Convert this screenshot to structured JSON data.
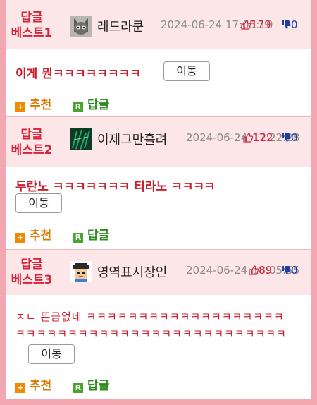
{
  "colors": {
    "outer_frame": "#f3a7b0",
    "header_bg": "#fde6e8",
    "accent_red": "#d6243b",
    "recommend_orange": "#f08a00",
    "reply_green": "#4aa52e",
    "downvote_blue": "#1b3fa6"
  },
  "entries": [
    {
      "badge_line1": "답글",
      "badge_line2": "베스트1",
      "avatar": "cat-avatar-icon",
      "nickname": "레드라쿤",
      "date": "2024-06-24",
      "time": "17:05:10",
      "upvotes": "179",
      "downvotes": "0",
      "content": "이게 뭔ㅋㅋㅋㅋㅋㅋㅋㅋ",
      "move_label": "이동",
      "recommend_label": "추천",
      "reply_label": "답글"
    },
    {
      "badge_line1": "답글",
      "badge_line2": "베스트2",
      "avatar": "green-texture-avatar-icon",
      "nickname": "이제그만흘려",
      "date": "2024-06-24",
      "time": "17:22:28",
      "upvotes": "122",
      "downvotes": "0",
      "content": "두란노 ㅋㅋㅋㅋㅋㅋㅋ 티라노 ㅋㅋㅋㅋ",
      "move_label": "이동",
      "recommend_label": "추천",
      "reply_label": "답글"
    },
    {
      "badge_line1": "답글",
      "badge_line2": "베스트3",
      "avatar": "pixel-character-avatar-icon",
      "nickname": "영역표시장인",
      "date": "2024-06-24",
      "time": "18:05:55",
      "upvotes": "89",
      "downvotes": "0",
      "content_line1": "ㅈㄴ 뜬금없네 ㅋㅋㅋㅋㅋㅋㅋㅋㅋㅋㅋㅋㅋㅋㅋㅋㅋㅋㅋ",
      "content_line2": "ㅋㅋㅋㅋㅋㅋㅋㅋㅋㅋㅋㅋㅋㅋㅋㅋㅋㅋㅋㅋㅋㅋㅋㅋㅋㅋ",
      "move_label": "이동",
      "recommend_label": "추천",
      "reply_label": "답글"
    }
  ]
}
